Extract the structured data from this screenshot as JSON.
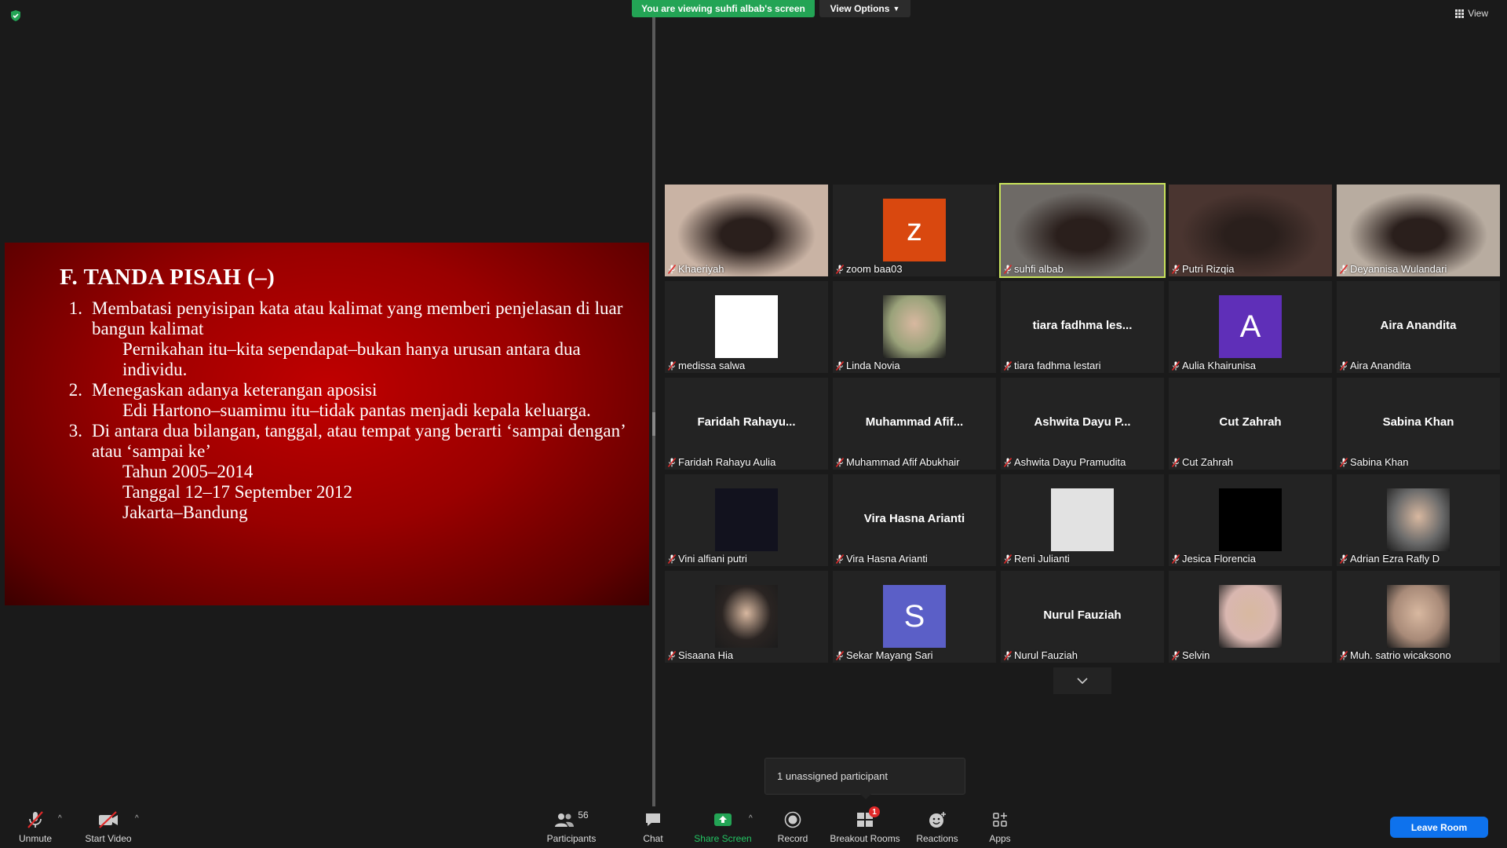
{
  "header": {
    "banner_text": "You are viewing suhfi albab's screen",
    "view_options_label": "View Options",
    "view_label": "View"
  },
  "slide": {
    "title": "F. TANDA PISAH (–)",
    "items": [
      {
        "num": "1.",
        "text": "Membatasi penyisipan kata atau kalimat yang memberi penjelasan di luar bangun kalimat",
        "examples": [
          "Pernikahan itu–kita sependapat–bukan hanya urusan antara dua individu."
        ]
      },
      {
        "num": "2.",
        "text": "Menegaskan adanya keterangan aposisi",
        "examples": [
          "Edi Hartono–suamimu itu–tidak pantas menjadi kepala keluarga."
        ]
      },
      {
        "num": "3.",
        "text": "Di antara dua bilangan, tanggal, atau tempat yang berarti ‘sampai dengan’ atau ‘sampai ke’",
        "examples": [
          "Tahun 2005–2014",
          "Tanggal 12–17 September 2012",
          "Jakarta–Bandung"
        ]
      }
    ]
  },
  "participants": [
    {
      "name": "Khaeriyah",
      "type": "photo",
      "bg": "#c9b3a4"
    },
    {
      "name": "zoom baa03",
      "type": "avatar",
      "letter": "z",
      "color": "#d9480f"
    },
    {
      "name": "suhfi albab",
      "type": "photo",
      "bg": "#6e6a66",
      "active": true
    },
    {
      "name": "Putri Rizqia",
      "type": "photo",
      "bg": "#4a3530"
    },
    {
      "name": "Deyannisa Wulandari",
      "type": "photo",
      "bg": "#b8aca0"
    },
    {
      "name": "medissa salwa",
      "type": "square",
      "color": "#ffffff"
    },
    {
      "name": "Linda Novia",
      "type": "smallphoto",
      "color": "#9aa27a"
    },
    {
      "name": "tiara fadhma lestari",
      "display": "tiara fadhma les...",
      "type": "text"
    },
    {
      "name": "Aulia Khairunisa",
      "type": "avatar",
      "letter": "A",
      "color": "#5f2fb8"
    },
    {
      "name": "Aira Anandita",
      "display": "Aira Anandita",
      "type": "text"
    },
    {
      "name": "Faridah Rahayu Aulia",
      "display": "Faridah Rahayu...",
      "type": "text"
    },
    {
      "name": "Muhammad Afif Abukhair",
      "display": "Muhammad Afif...",
      "type": "text"
    },
    {
      "name": "Ashwita Dayu Pramudita",
      "display": "Ashwita Dayu P...",
      "type": "text"
    },
    {
      "name": "Cut Zahrah",
      "display": "Cut Zahrah",
      "type": "text"
    },
    {
      "name": "Sabina Khan",
      "display": "Sabina Khan",
      "type": "text"
    },
    {
      "name": "Vini alfiani putri",
      "type": "square",
      "color": "#12121e"
    },
    {
      "name": "Vira Hasna Arianti",
      "display": "Vira Hasna Arianti",
      "type": "text"
    },
    {
      "name": "Reni Julianti",
      "type": "square",
      "color": "#e2e2e2"
    },
    {
      "name": "Jesica Florencia",
      "type": "square",
      "color": "#000000"
    },
    {
      "name": "Adrian Ezra Rafly D",
      "type": "smallphoto",
      "color": "#6a6a6a"
    },
    {
      "name": "Sisaana Hia",
      "type": "smallphoto",
      "color": "#2a2422"
    },
    {
      "name": "Sekar Mayang Sari",
      "type": "avatar",
      "letter": "S",
      "color": "#5b5fc7"
    },
    {
      "name": "Nurul Fauziah",
      "display": "Nurul Fauziah",
      "type": "text"
    },
    {
      "name": "Selvin",
      "type": "smallphoto",
      "color": "#d9b7b0"
    },
    {
      "name": "Muh. satrio wicaksono",
      "type": "smallphoto",
      "color": "#a88a78"
    }
  ],
  "tooltip": {
    "text": "1 unassigned participant"
  },
  "toolbar": {
    "unmute": "Unmute",
    "start_video": "Start Video",
    "participants": "Participants",
    "participants_count": "56",
    "chat": "Chat",
    "share_screen": "Share Screen",
    "record": "Record",
    "breakout_rooms": "Breakout Rooms",
    "breakout_badge": "1",
    "reactions": "Reactions",
    "apps": "Apps",
    "leave_room": "Leave Room"
  },
  "colors": {
    "banner": "#23a455",
    "active_speaker": "#c8e25b",
    "leave": "#0e72ed",
    "share": "#23a455"
  }
}
